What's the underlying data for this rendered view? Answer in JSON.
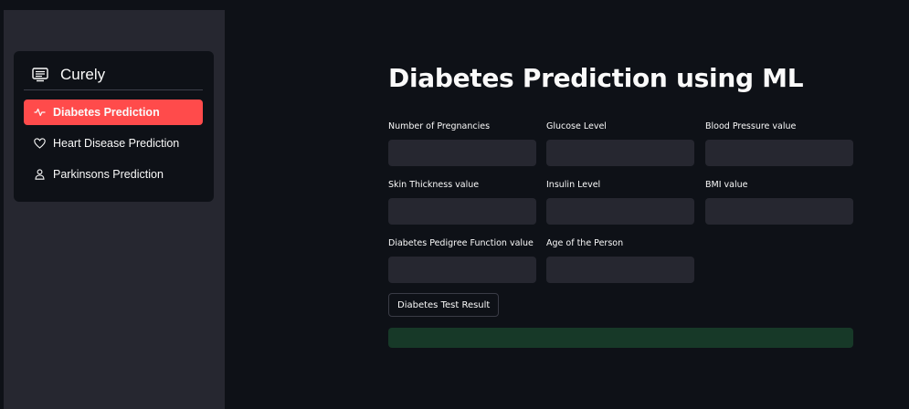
{
  "sidebar": {
    "menu": {
      "title": "Curely",
      "logo_icon": "clipboard-list-icon",
      "items": [
        {
          "label": "Diabetes Prediction",
          "icon": "activity-icon",
          "active": true
        },
        {
          "label": "Heart Disease Prediction",
          "icon": "heart-icon",
          "active": false
        },
        {
          "label": "Parkinsons Prediction",
          "icon": "person-icon",
          "active": false
        }
      ]
    }
  },
  "main": {
    "title": "Diabetes Prediction using ML",
    "fields": [
      {
        "label": "Number of Pregnancies",
        "value": ""
      },
      {
        "label": "Glucose Level",
        "value": ""
      },
      {
        "label": "Blood Pressure value",
        "value": ""
      },
      {
        "label": "Skin Thickness value",
        "value": ""
      },
      {
        "label": "Insulin Level",
        "value": ""
      },
      {
        "label": "BMI value",
        "value": ""
      },
      {
        "label": "Diabetes Pedigree Function value",
        "value": ""
      },
      {
        "label": "Age of the Person",
        "value": ""
      }
    ],
    "button_label": "Diabetes Test Result",
    "result_text": ""
  },
  "colors": {
    "background": "#0e1117",
    "sidebar": "#262730",
    "accent": "#ff4b4b",
    "input": "#262730",
    "success": "#173928"
  }
}
